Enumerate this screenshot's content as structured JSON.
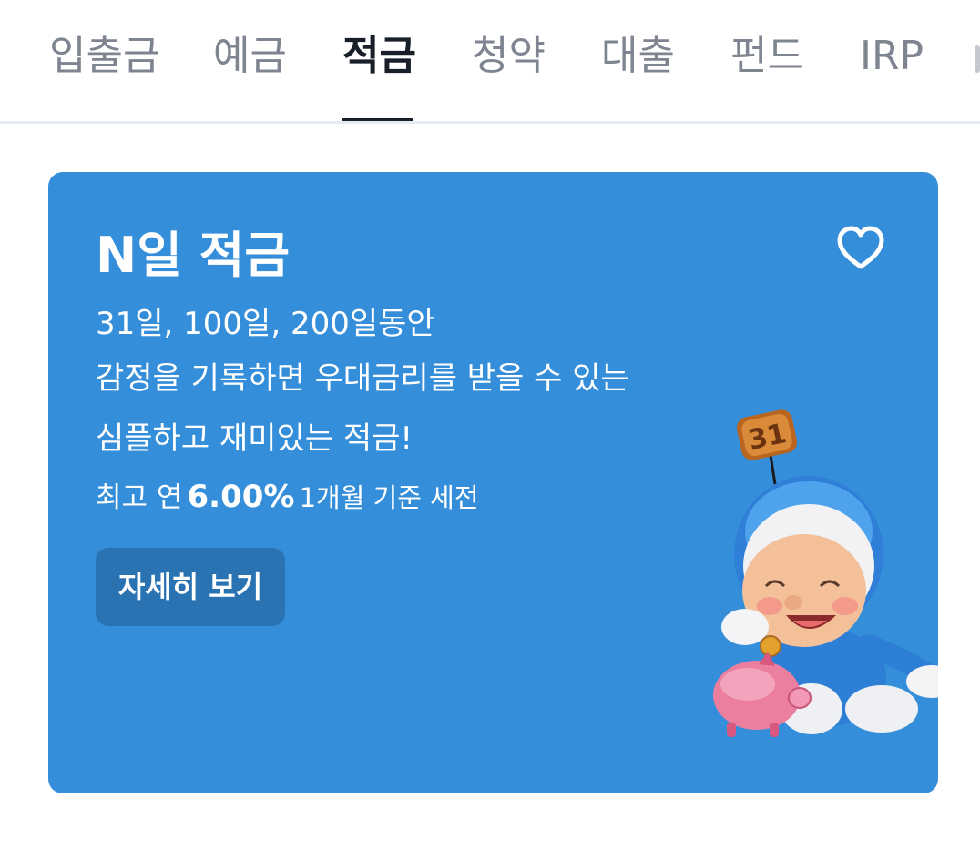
{
  "tabs": [
    {
      "label": "입출금",
      "active": false
    },
    {
      "label": "예금",
      "active": false
    },
    {
      "label": "적금",
      "active": true
    },
    {
      "label": "청약",
      "active": false
    },
    {
      "label": "대출",
      "active": false
    },
    {
      "label": "펀드",
      "active": false
    },
    {
      "label": "IRP",
      "active": false
    }
  ],
  "card": {
    "title": "N일 적금",
    "line1": "31일, 100일, 200일동안",
    "line2": "감정을 기록하면 우대금리를 받을 수 있는",
    "line3": "심플하고 재미있는 적금!",
    "rate_prefix": "최고 연",
    "rate_value": "6.00%",
    "rate_suffix": "1개월 기준 세전",
    "button_label": "자세히 보기",
    "mascot_badge": "31",
    "favorite_icon": "heart-outline-icon"
  },
  "colors": {
    "card_bg": "#348ed9",
    "button_bg": "#2a73b3",
    "tab_active": "#191f28",
    "tab_inactive": "#7e8590"
  }
}
